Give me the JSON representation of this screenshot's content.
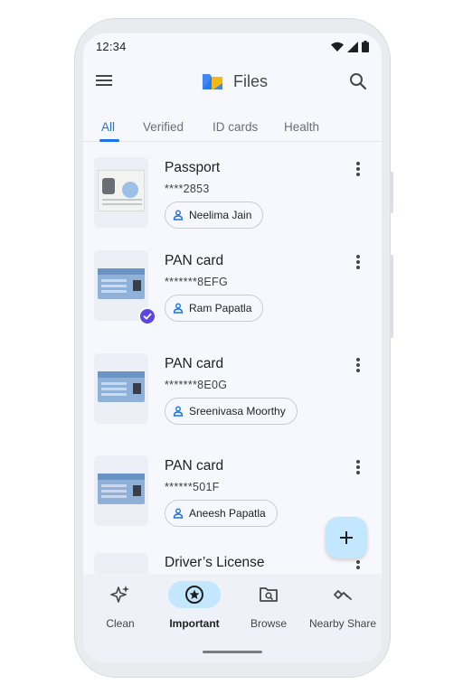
{
  "status_bar": {
    "time": "12:34"
  },
  "app_bar": {
    "title": "Files",
    "icons": [
      "menu-icon",
      "files-logo-icon",
      "search-icon"
    ]
  },
  "tabs": [
    {
      "label": "All",
      "active": true
    },
    {
      "label": "Verified",
      "active": false
    },
    {
      "label": "ID cards",
      "active": false
    },
    {
      "label": "Health",
      "active": false
    }
  ],
  "documents": [
    {
      "title": "Passport",
      "number": "****2853",
      "owner": "Neelima Jain",
      "verified": false
    },
    {
      "title": "PAN card",
      "number": "*******8EFG",
      "owner": "Ram Papatla",
      "verified": true
    },
    {
      "title": "PAN card",
      "number": "*******8E0G",
      "owner": "Sreenivasa Moorthy",
      "verified": false
    },
    {
      "title": "PAN card",
      "number": "******501F",
      "owner": "Aneesh Papatla",
      "verified": false
    },
    {
      "title": "Driver’s License"
    }
  ],
  "fab": {
    "icon": "plus-icon"
  },
  "bottom_nav": [
    {
      "label": "Clean",
      "icon": "sparkle-icon",
      "active": false
    },
    {
      "label": "Important",
      "icon": "star-circle-icon",
      "active": true
    },
    {
      "label": "Browse",
      "icon": "folder-search-icon",
      "active": false
    },
    {
      "label": "Nearby Share",
      "icon": "nearby-share-icon",
      "active": false
    }
  ],
  "colors": {
    "accent": "#1a73e8",
    "nav_active": "#c2e7ff",
    "verified_badge": "#5c45e6",
    "screen_bg": "#f7f8fd"
  }
}
